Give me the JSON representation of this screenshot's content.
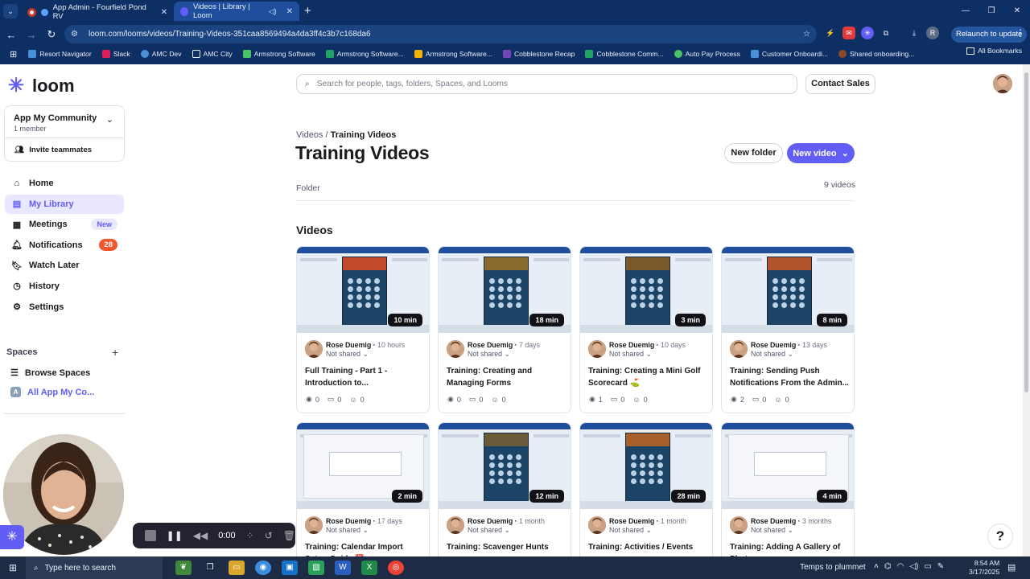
{
  "browser": {
    "tabs": [
      {
        "title": "App Admin - Fourfield Pond RV",
        "active": false
      },
      {
        "title": "Videos | Library | Loom",
        "active": true
      }
    ],
    "url": "loom.com/looms/videos/Training-Videos-351caa8569494a4da3ff4c3b7c168da6",
    "relaunch_label": "Relaunch to update",
    "bookmarks": [
      {
        "label": "Resort Navigator",
        "icon": "globe-icon"
      },
      {
        "label": "Slack",
        "icon": "slack-icon"
      },
      {
        "label": "AMC Dev",
        "icon": "globe-icon"
      },
      {
        "label": "AMC City",
        "icon": "folder-icon"
      },
      {
        "label": "Armstrong Software",
        "icon": "feather-icon"
      },
      {
        "label": "Armstrong Software...",
        "icon": "sheets-icon"
      },
      {
        "label": "Armstrong Software...",
        "icon": "doc-icon"
      },
      {
        "label": "Cobblestone Recap",
        "icon": "form-icon"
      },
      {
        "label": "Cobblestone Comm...",
        "icon": "sheets-icon"
      },
      {
        "label": "Auto Pay Process",
        "icon": "globe-icon"
      },
      {
        "label": "Customer Onboardi...",
        "icon": "doc-icon"
      },
      {
        "label": "Shared onboarding...",
        "icon": "avatar-icon"
      }
    ],
    "all_bookmarks_label": "All Bookmarks"
  },
  "sidebar": {
    "logo_text": "loom",
    "workspace": {
      "name": "App My Community",
      "members": "1 member",
      "invite_label": "Invite teammates"
    },
    "nav": [
      {
        "label": "Home",
        "icon": "home-icon",
        "active": false
      },
      {
        "label": "My Library",
        "icon": "library-icon",
        "active": true
      },
      {
        "label": "Meetings",
        "icon": "grid-icon",
        "active": false,
        "badge": "New"
      },
      {
        "label": "Notifications",
        "icon": "bell-icon",
        "active": false,
        "count": "28"
      },
      {
        "label": "Watch Later",
        "icon": "bookmark-icon",
        "active": false
      },
      {
        "label": "History",
        "icon": "clock-icon",
        "active": false
      },
      {
        "label": "Settings",
        "icon": "gear-icon",
        "active": false
      }
    ],
    "spaces_label": "Spaces",
    "browse_spaces_label": "Browse Spaces",
    "space_name": "All App My Co...",
    "space_letter": "A"
  },
  "recorder": {
    "time": "0:00"
  },
  "header": {
    "search_placeholder": "Search for people, tags, folders, Spaces, and Looms",
    "contact_sales_label": "Contact Sales"
  },
  "folder": {
    "breadcrumb_root": "Videos",
    "breadcrumb_sep": "/",
    "breadcrumb_current": "Training Videos",
    "title": "Training Videos",
    "new_folder_label": "New folder",
    "new_video_label": "New video",
    "type_label": "Folder",
    "video_count": "9 videos",
    "section_title": "Videos"
  },
  "videos": [
    {
      "duration": "10 min",
      "author": "Rose Duemig",
      "ago": "10 hours",
      "shared": "Not shared",
      "title": "Full Training - Part 1 - Introduction to...",
      "views": "0",
      "comments": "0",
      "reactions": "0",
      "accent": "#c24a2a"
    },
    {
      "duration": "18 min",
      "author": "Rose Duemig",
      "ago": "7 days",
      "shared": "Not shared",
      "title": "Training: Creating and Managing Forms",
      "views": "0",
      "comments": "0",
      "reactions": "0",
      "accent": "#8a6a2f"
    },
    {
      "duration": "3 min",
      "author": "Rose Duemig",
      "ago": "10 days",
      "shared": "Not shared",
      "title": "Training: Creating a Mini Golf Scorecard ⛳",
      "views": "1",
      "comments": "0",
      "reactions": "0",
      "accent": "#7b5a2b"
    },
    {
      "duration": "8 min",
      "author": "Rose Duemig",
      "ago": "13 days",
      "shared": "Not shared",
      "title": "Training: Sending Push Notifications From the Admin...",
      "views": "2",
      "comments": "0",
      "reactions": "0",
      "accent": "#b2542b"
    },
    {
      "duration": "2 min",
      "author": "Rose Duemig",
      "ago": "17 days",
      "shared": "Not shared",
      "title": "Training: Calendar Import Setup Guide 📅",
      "views": "",
      "comments": "",
      "reactions": "",
      "accent": "#dfe6ef"
    },
    {
      "duration": "12 min",
      "author": "Rose Duemig",
      "ago": "1 month",
      "shared": "Not shared",
      "title": "Training: Scavenger Hunts",
      "views": "",
      "comments": "",
      "reactions": "",
      "accent": "#6b5a3a"
    },
    {
      "duration": "28 min",
      "author": "Rose Duemig",
      "ago": "1 month",
      "shared": "Not shared",
      "title": "Training: Activities / Events",
      "views": "",
      "comments": "",
      "reactions": "",
      "accent": "#a8602b"
    },
    {
      "duration": "4 min",
      "author": "Rose Duemig",
      "ago": "3 months",
      "shared": "Not shared",
      "title": "Training: Adding A Gallery of Photos",
      "views": "",
      "comments": "",
      "reactions": "",
      "accent": "#e3e6ec"
    }
  ],
  "taskbar": {
    "search_placeholder": "Type here to search",
    "weather": "Temps to plummet",
    "time": "8:54 AM",
    "date": "3/17/2025"
  },
  "colors": {
    "brand": "#625df5",
    "badge_red": "#f0572c",
    "browser_bg": "#0e2f63"
  }
}
